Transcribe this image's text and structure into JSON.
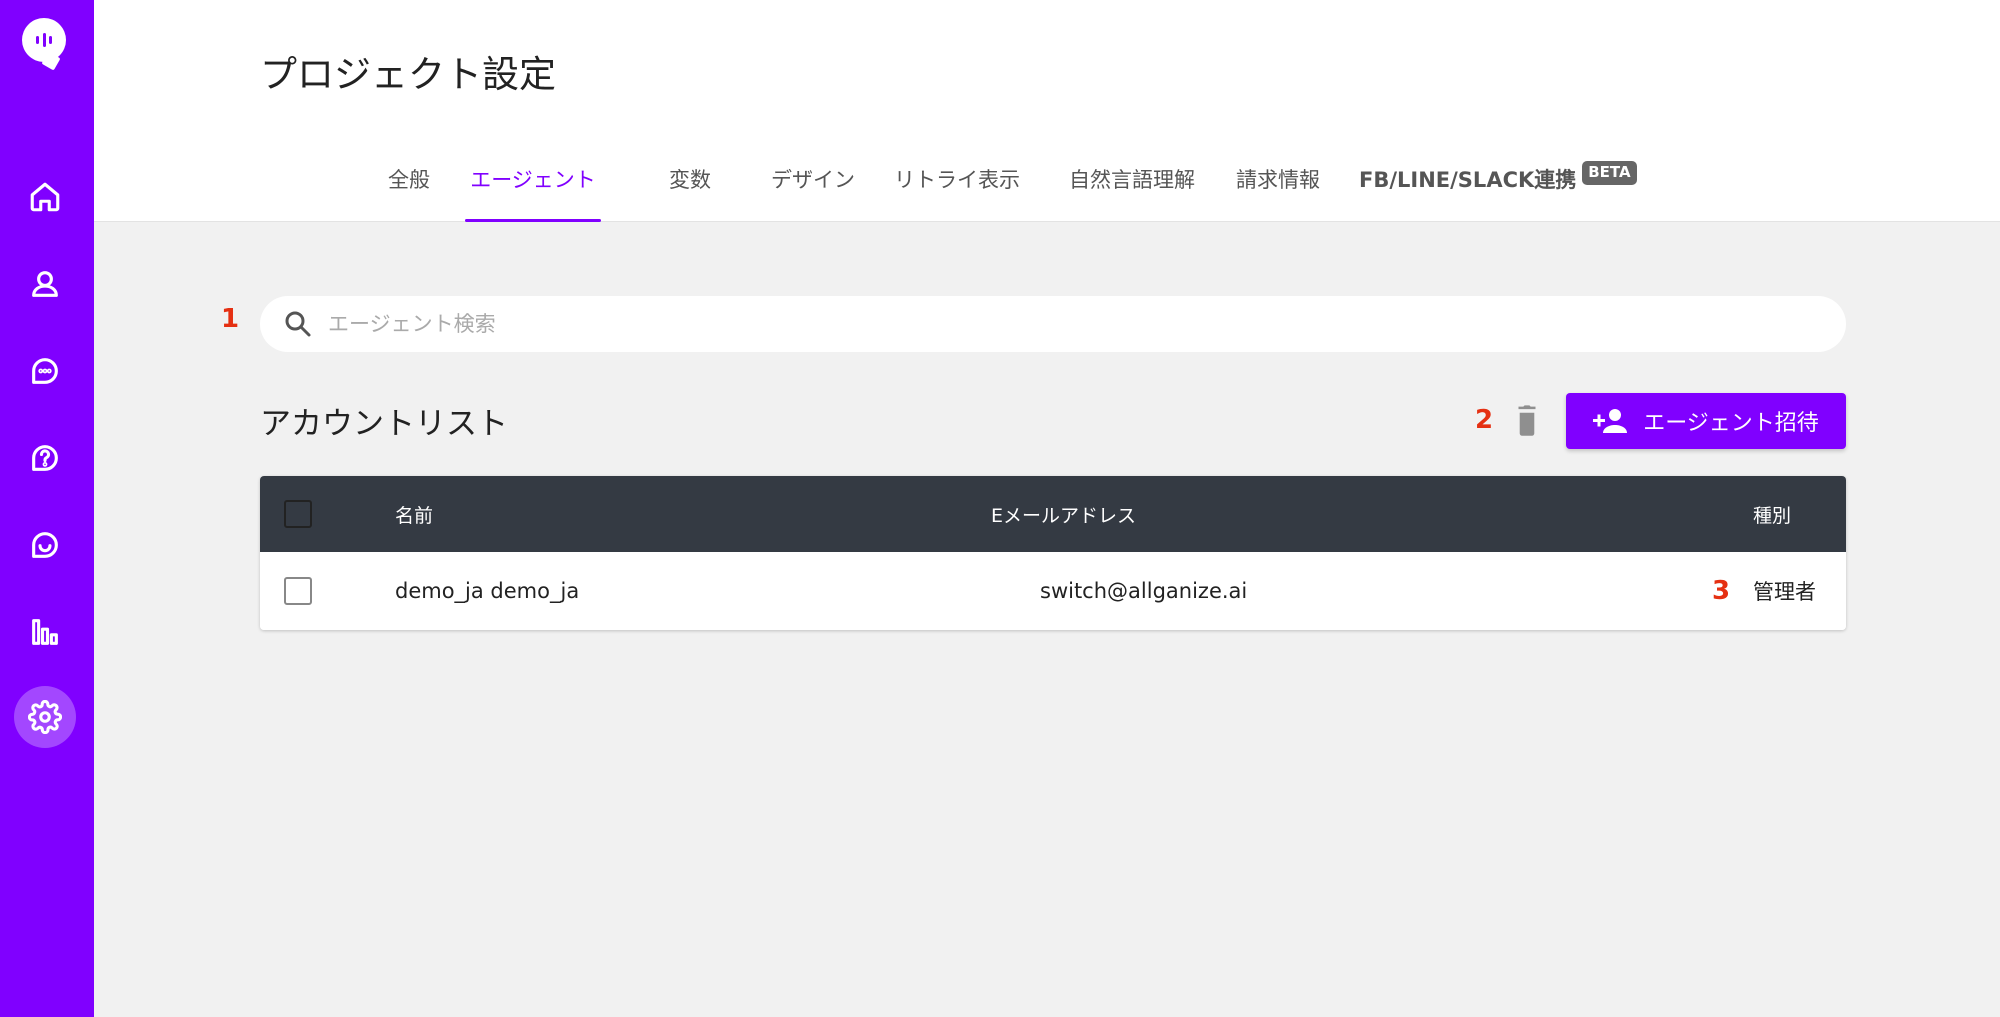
{
  "nav": {
    "items": [
      {
        "name": "home-icon",
        "active": false
      },
      {
        "name": "user-icon",
        "active": false
      },
      {
        "name": "chat-icon",
        "active": false
      },
      {
        "name": "help-icon",
        "active": false
      },
      {
        "name": "smile-icon",
        "active": false
      },
      {
        "name": "stats-icon",
        "active": false
      },
      {
        "name": "gear-icon",
        "active": true
      }
    ]
  },
  "header": {
    "title": "プロジェクト設定",
    "tabs": [
      {
        "label": "全般"
      },
      {
        "label": "エージェント",
        "active": true
      },
      {
        "label": "変数"
      },
      {
        "label": "デザイン"
      },
      {
        "label": "リトライ表示"
      },
      {
        "label": "自然言語理解"
      },
      {
        "label": "請求情報"
      },
      {
        "label": "FB/LINE/SLACK連携",
        "badge": "BETA"
      }
    ]
  },
  "markers": {
    "m1": "1",
    "m2": "2",
    "m3": "3"
  },
  "search": {
    "placeholder": "エージェント検索",
    "value": ""
  },
  "account_list": {
    "title": "アカウントリスト",
    "invite_label": "エージェント招待"
  },
  "table": {
    "headers": {
      "name": "名前",
      "email": "Eメールアドレス",
      "type": "種別"
    },
    "rows": [
      {
        "name": "demo_ja demo_ja",
        "email": "switch@allganize.ai",
        "type": "管理者",
        "checked": false
      }
    ]
  },
  "colors": {
    "accent": "#8000ff",
    "header_bg": "#343a43",
    "marker": "#e53012"
  }
}
